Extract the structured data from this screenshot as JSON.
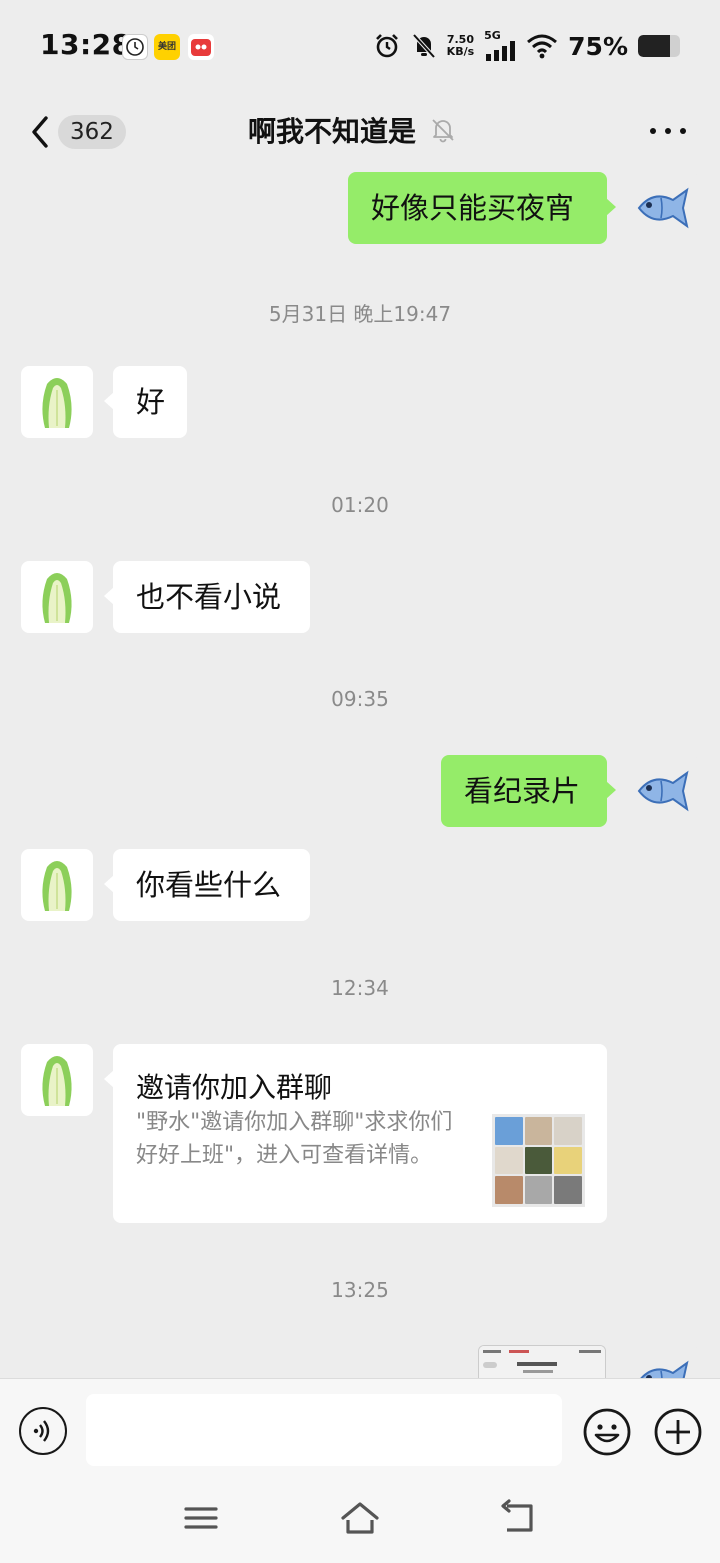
{
  "status_bar": {
    "time": "13:28",
    "app_icons": [
      "clock-app-icon",
      "meituan-app-icon",
      "red-app-icon"
    ],
    "meituan_label": "美团",
    "net_speed_value": "7.50",
    "net_speed_unit": "KB/s",
    "network": "5G",
    "battery_percent": "75%",
    "battery_level": 0.75
  },
  "header": {
    "back_badge": "362",
    "title": "啊我不知道是",
    "muted": true
  },
  "messages": [
    {
      "type": "text",
      "side": "out",
      "text": "好像只能买夜宵"
    },
    {
      "type": "time",
      "text": "5月31日 晚上19:47"
    },
    {
      "type": "text",
      "side": "in",
      "text": "好"
    },
    {
      "type": "time",
      "text": "01:20"
    },
    {
      "type": "text",
      "side": "in",
      "text": "也不看小说"
    },
    {
      "type": "time",
      "text": "09:35"
    },
    {
      "type": "text",
      "side": "out",
      "text": "看纪录片"
    },
    {
      "type": "text",
      "side": "in",
      "text": "你看些什么"
    },
    {
      "type": "time",
      "text": "12:34"
    },
    {
      "type": "invite",
      "side": "in",
      "title": "邀请你加入群聊",
      "description": "\"野水\"邀请你加入群聊\"求求你们好好上班\"，进入可查看详情。"
    },
    {
      "type": "time",
      "text": "13:25"
    },
    {
      "type": "image",
      "side": "out"
    }
  ],
  "input": {
    "placeholder": "",
    "value": ""
  },
  "colors": {
    "background": "#ededed",
    "bubble_out": "#95ec69",
    "bubble_in": "#ffffff",
    "timestamp": "#8a8a8a"
  }
}
